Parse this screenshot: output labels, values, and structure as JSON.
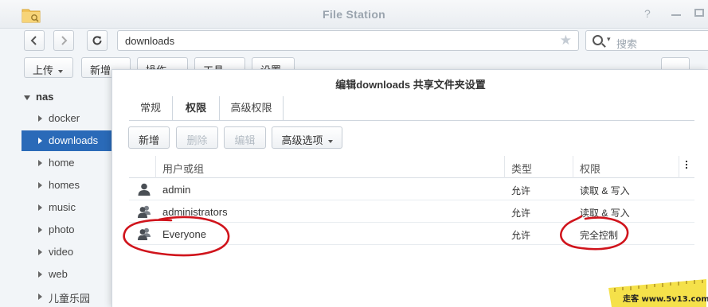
{
  "window": {
    "title": "File Station",
    "help_label": "?"
  },
  "nav": {
    "path": "downloads",
    "search_placeholder": "搜索"
  },
  "toolbar": {
    "upload_label": "上传",
    "create_label": "新增",
    "action_label": "操作",
    "tools_label": "工具",
    "settings_label": "设置"
  },
  "sidebar": {
    "root": "nas",
    "items": [
      {
        "label": "docker"
      },
      {
        "label": "downloads"
      },
      {
        "label": "home"
      },
      {
        "label": "homes"
      },
      {
        "label": "music"
      },
      {
        "label": "photo"
      },
      {
        "label": "video"
      },
      {
        "label": "web"
      },
      {
        "label": "儿童乐园"
      }
    ],
    "selected": "downloads"
  },
  "dialog": {
    "title": "编辑downloads 共享文件夹设置",
    "tabs": [
      {
        "label": "常规"
      },
      {
        "label": "权限"
      },
      {
        "label": "高级权限"
      }
    ],
    "active_tab": "权限",
    "buttons": {
      "create": "新增",
      "delete": "删除",
      "edit": "编辑",
      "advanced": "高级选项"
    },
    "table": {
      "headers": {
        "user": "用户或组",
        "type": "类型",
        "perm": "权限"
      },
      "rows": [
        {
          "name": "admin",
          "type": "允许",
          "perm": "读取 & 写入",
          "icon": "user-icon"
        },
        {
          "name": "administrators",
          "type": "允许",
          "perm": "读取 & 写入",
          "icon": "group-icon"
        },
        {
          "name": "Everyone",
          "type": "允许",
          "perm": "完全控制",
          "icon": "group-icon"
        }
      ]
    }
  },
  "watermark": {
    "text": "走客 www.5v13.com"
  },
  "colors": {
    "selection": "#2a6ab8",
    "annotation": "#d0141c",
    "watermark_bg": "#f5e14a"
  }
}
